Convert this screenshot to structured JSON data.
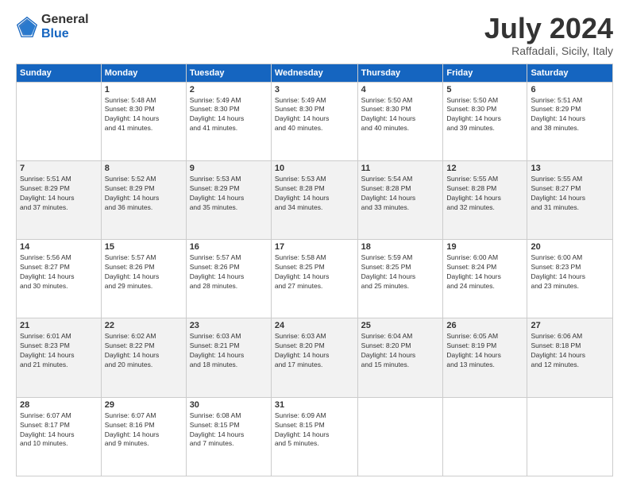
{
  "logo": {
    "general": "General",
    "blue": "Blue"
  },
  "header": {
    "month": "July 2024",
    "location": "Raffadali, Sicily, Italy"
  },
  "weekdays": [
    "Sunday",
    "Monday",
    "Tuesday",
    "Wednesday",
    "Thursday",
    "Friday",
    "Saturday"
  ],
  "weeks": [
    [
      {
        "day": "",
        "info": ""
      },
      {
        "day": "1",
        "info": "Sunrise: 5:48 AM\nSunset: 8:30 PM\nDaylight: 14 hours\nand 41 minutes."
      },
      {
        "day": "2",
        "info": "Sunrise: 5:49 AM\nSunset: 8:30 PM\nDaylight: 14 hours\nand 41 minutes."
      },
      {
        "day": "3",
        "info": "Sunrise: 5:49 AM\nSunset: 8:30 PM\nDaylight: 14 hours\nand 40 minutes."
      },
      {
        "day": "4",
        "info": "Sunrise: 5:50 AM\nSunset: 8:30 PM\nDaylight: 14 hours\nand 40 minutes."
      },
      {
        "day": "5",
        "info": "Sunrise: 5:50 AM\nSunset: 8:30 PM\nDaylight: 14 hours\nand 39 minutes."
      },
      {
        "day": "6",
        "info": "Sunrise: 5:51 AM\nSunset: 8:29 PM\nDaylight: 14 hours\nand 38 minutes."
      }
    ],
    [
      {
        "day": "7",
        "info": "Sunrise: 5:51 AM\nSunset: 8:29 PM\nDaylight: 14 hours\nand 37 minutes."
      },
      {
        "day": "8",
        "info": "Sunrise: 5:52 AM\nSunset: 8:29 PM\nDaylight: 14 hours\nand 36 minutes."
      },
      {
        "day": "9",
        "info": "Sunrise: 5:53 AM\nSunset: 8:29 PM\nDaylight: 14 hours\nand 35 minutes."
      },
      {
        "day": "10",
        "info": "Sunrise: 5:53 AM\nSunset: 8:28 PM\nDaylight: 14 hours\nand 34 minutes."
      },
      {
        "day": "11",
        "info": "Sunrise: 5:54 AM\nSunset: 8:28 PM\nDaylight: 14 hours\nand 33 minutes."
      },
      {
        "day": "12",
        "info": "Sunrise: 5:55 AM\nSunset: 8:28 PM\nDaylight: 14 hours\nand 32 minutes."
      },
      {
        "day": "13",
        "info": "Sunrise: 5:55 AM\nSunset: 8:27 PM\nDaylight: 14 hours\nand 31 minutes."
      }
    ],
    [
      {
        "day": "14",
        "info": "Sunrise: 5:56 AM\nSunset: 8:27 PM\nDaylight: 14 hours\nand 30 minutes."
      },
      {
        "day": "15",
        "info": "Sunrise: 5:57 AM\nSunset: 8:26 PM\nDaylight: 14 hours\nand 29 minutes."
      },
      {
        "day": "16",
        "info": "Sunrise: 5:57 AM\nSunset: 8:26 PM\nDaylight: 14 hours\nand 28 minutes."
      },
      {
        "day": "17",
        "info": "Sunrise: 5:58 AM\nSunset: 8:25 PM\nDaylight: 14 hours\nand 27 minutes."
      },
      {
        "day": "18",
        "info": "Sunrise: 5:59 AM\nSunset: 8:25 PM\nDaylight: 14 hours\nand 25 minutes."
      },
      {
        "day": "19",
        "info": "Sunrise: 6:00 AM\nSunset: 8:24 PM\nDaylight: 14 hours\nand 24 minutes."
      },
      {
        "day": "20",
        "info": "Sunrise: 6:00 AM\nSunset: 8:23 PM\nDaylight: 14 hours\nand 23 minutes."
      }
    ],
    [
      {
        "day": "21",
        "info": "Sunrise: 6:01 AM\nSunset: 8:23 PM\nDaylight: 14 hours\nand 21 minutes."
      },
      {
        "day": "22",
        "info": "Sunrise: 6:02 AM\nSunset: 8:22 PM\nDaylight: 14 hours\nand 20 minutes."
      },
      {
        "day": "23",
        "info": "Sunrise: 6:03 AM\nSunset: 8:21 PM\nDaylight: 14 hours\nand 18 minutes."
      },
      {
        "day": "24",
        "info": "Sunrise: 6:03 AM\nSunset: 8:20 PM\nDaylight: 14 hours\nand 17 minutes."
      },
      {
        "day": "25",
        "info": "Sunrise: 6:04 AM\nSunset: 8:20 PM\nDaylight: 14 hours\nand 15 minutes."
      },
      {
        "day": "26",
        "info": "Sunrise: 6:05 AM\nSunset: 8:19 PM\nDaylight: 14 hours\nand 13 minutes."
      },
      {
        "day": "27",
        "info": "Sunrise: 6:06 AM\nSunset: 8:18 PM\nDaylight: 14 hours\nand 12 minutes."
      }
    ],
    [
      {
        "day": "28",
        "info": "Sunrise: 6:07 AM\nSunset: 8:17 PM\nDaylight: 14 hours\nand 10 minutes."
      },
      {
        "day": "29",
        "info": "Sunrise: 6:07 AM\nSunset: 8:16 PM\nDaylight: 14 hours\nand 9 minutes."
      },
      {
        "day": "30",
        "info": "Sunrise: 6:08 AM\nSunset: 8:15 PM\nDaylight: 14 hours\nand 7 minutes."
      },
      {
        "day": "31",
        "info": "Sunrise: 6:09 AM\nSunset: 8:15 PM\nDaylight: 14 hours\nand 5 minutes."
      },
      {
        "day": "",
        "info": ""
      },
      {
        "day": "",
        "info": ""
      },
      {
        "day": "",
        "info": ""
      }
    ]
  ]
}
